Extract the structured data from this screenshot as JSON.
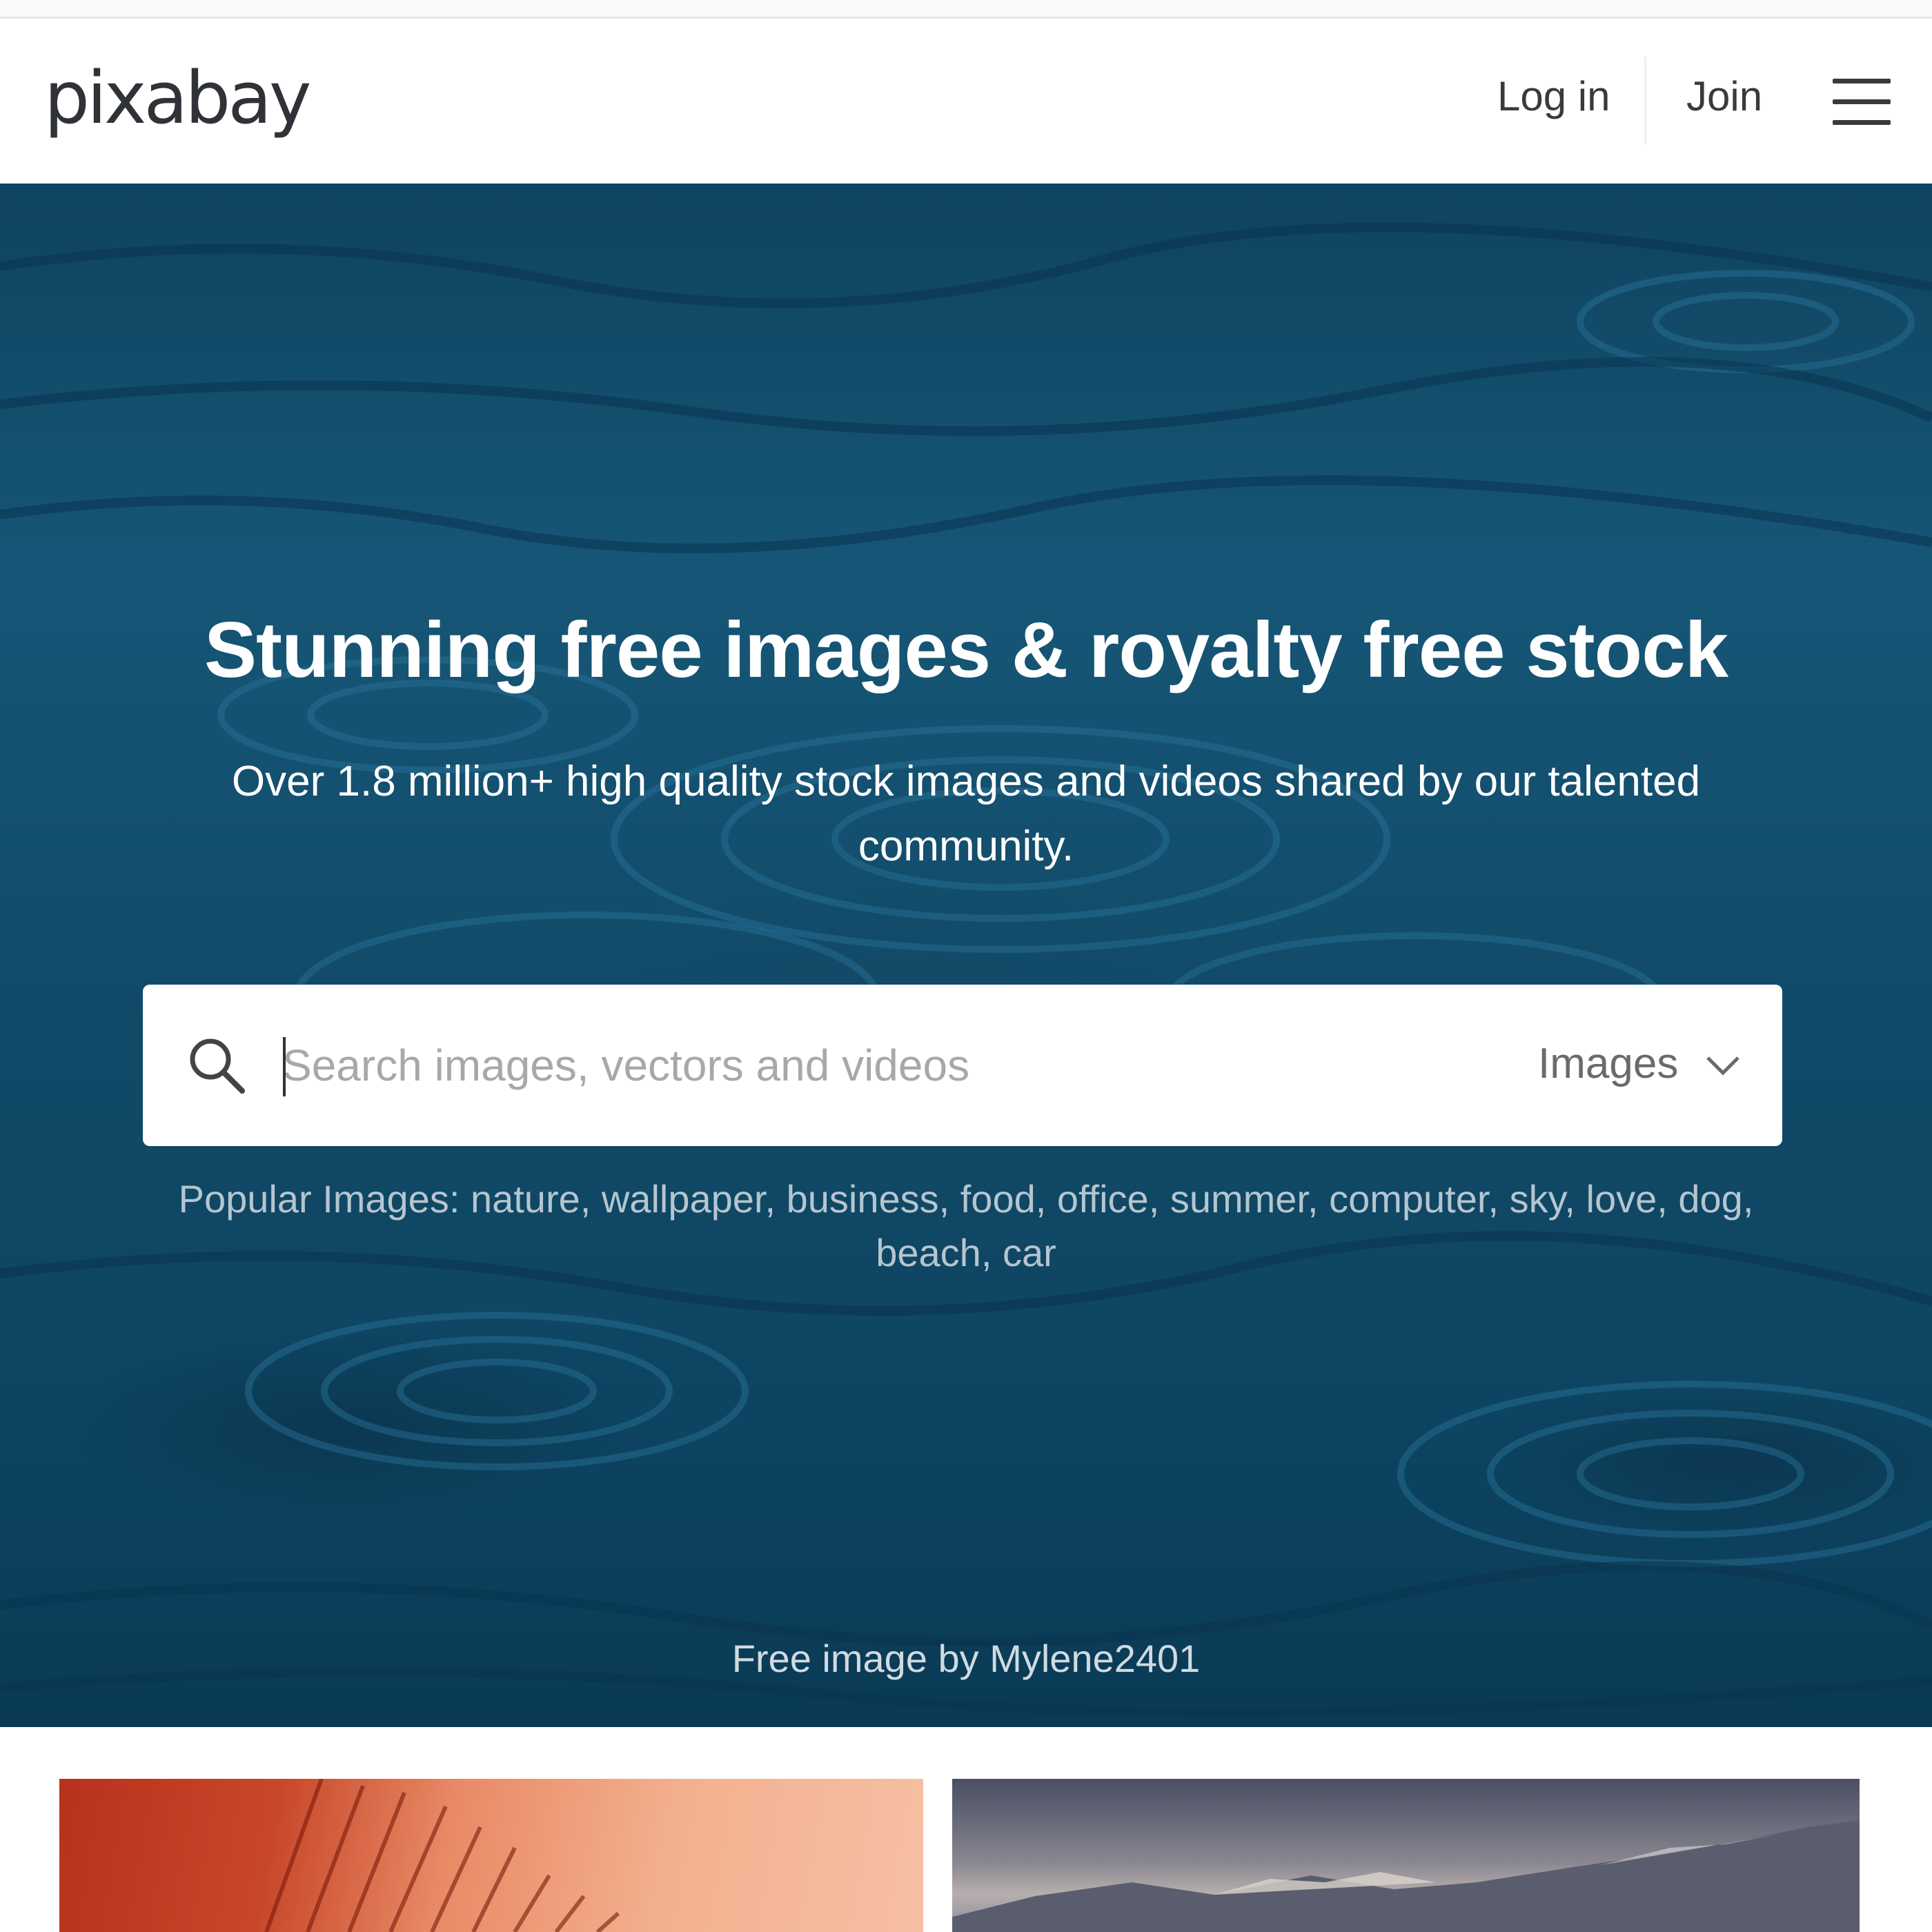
{
  "header": {
    "logo_text": "pixabay",
    "login_label": "Log in",
    "join_label": "Join",
    "menu_icon": "hamburger-icon"
  },
  "hero": {
    "title": "Stunning free images & royalty free stock",
    "subtitle": "Over 1.8 million+ high quality stock images and videos shared by our talented community.",
    "search": {
      "placeholder": "Search images, vectors and videos",
      "value": "",
      "type_selected": "Images",
      "search_icon": "search-icon",
      "dropdown_icon": "chevron-down-icon"
    },
    "popular": {
      "label": "Popular Images:",
      "items": [
        "nature,",
        "wallpaper,",
        "business,",
        "food,",
        "office,",
        "summer,",
        "computer,",
        "sky,",
        "love,",
        "dog,",
        "beach,",
        "car"
      ]
    },
    "credit": "Free image by Mylene2401"
  },
  "colors": {
    "hero_water": "#165676",
    "text_dark": "#2c2c2c",
    "search_bg": "#ffffff"
  }
}
